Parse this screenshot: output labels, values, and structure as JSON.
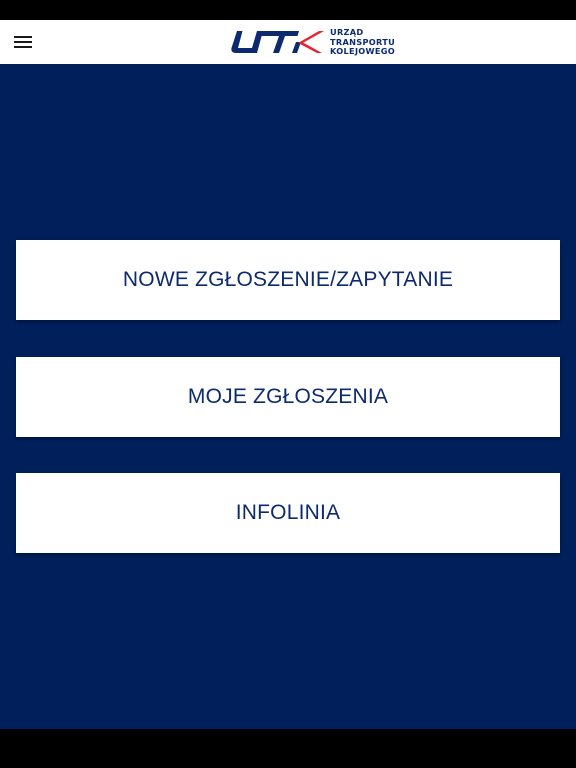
{
  "header": {
    "menu_icon": "hamburger-menu-icon",
    "logo": {
      "mark": "UTK",
      "lines": [
        "URZĄD",
        "TRANSPORTU",
        "KOLEJOWEGO"
      ]
    }
  },
  "menu": {
    "items": [
      {
        "label": "NOWE ZGŁOSZENIE/ZAPYTANIE"
      },
      {
        "label": "MOJE ZGŁOSZENIA"
      },
      {
        "label": "INFOLINIA"
      }
    ]
  },
  "colors": {
    "background": "#001f5b",
    "brand_blue": "#0e2a6e",
    "brand_red": "#e3262f",
    "card": "#ffffff"
  }
}
